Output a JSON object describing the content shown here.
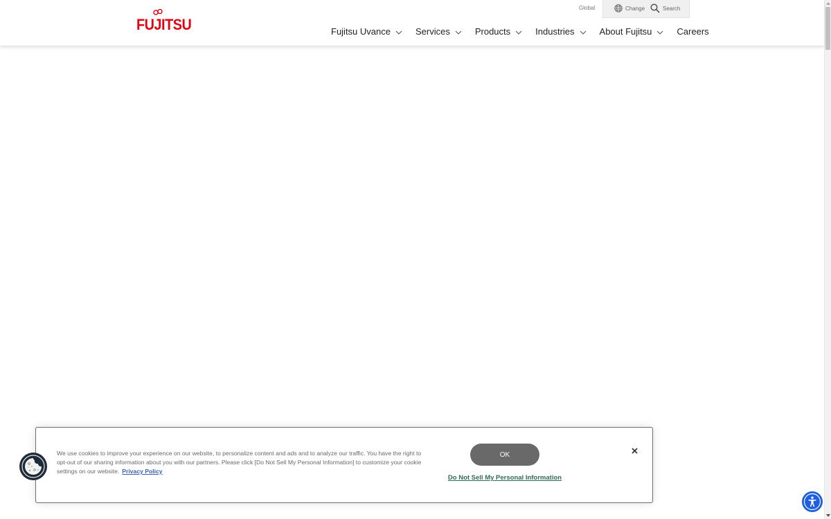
{
  "header": {
    "logo_text": "FUJITSU",
    "utility": {
      "region_label": "Global",
      "change_label": "Change",
      "search_label": "Search"
    },
    "nav": [
      {
        "label": "Fujitsu Uvance",
        "has_dropdown": true
      },
      {
        "label": "Services",
        "has_dropdown": true
      },
      {
        "label": "Products",
        "has_dropdown": true
      },
      {
        "label": "Industries",
        "has_dropdown": true
      },
      {
        "label": "About Fujitsu",
        "has_dropdown": true
      },
      {
        "label": "Careers",
        "has_dropdown": false
      }
    ]
  },
  "cookie_banner": {
    "text": "We use cookies to improve your experience on our website, to personalize content and ads and to analyze our traffic. You have the right to opt-out of our sharing information about you with our partners. Please click [Do Not Sell My Personal Information] to customize your cookie settings on our website.",
    "privacy_link": "Privacy Policy",
    "ok_label": "OK",
    "do_not_sell_label": "Do Not Sell My Personal Information",
    "close_icon": "close-icon"
  },
  "floating": {
    "cookie_settings_icon": "cookie-icon",
    "accessibility_icon": "accessibility-icon"
  },
  "colors": {
    "brand": "#e60012",
    "ok_button": "#696969",
    "dns_link": "#2d6e52",
    "privacy_link": "#3860be",
    "accessibility": "#1e5fe0"
  }
}
